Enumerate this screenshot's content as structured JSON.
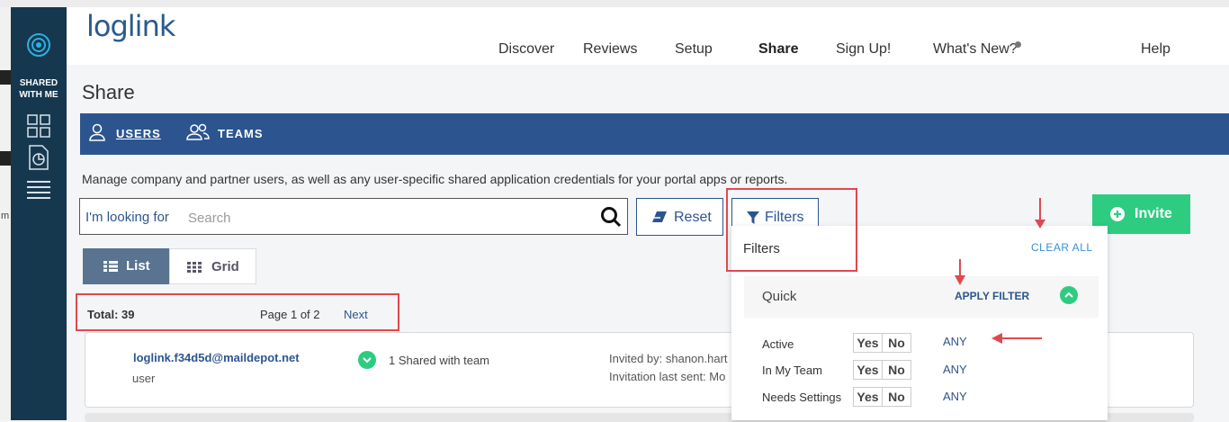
{
  "sidebar": {
    "shared_label_line1": "SHARED",
    "shared_label_line2": "WITH ME"
  },
  "logo": {
    "text": "loglink"
  },
  "nav": [
    {
      "label": "Discover"
    },
    {
      "label": "Reviews"
    },
    {
      "label": "Setup"
    },
    {
      "label": "Share"
    },
    {
      "label": "Sign Up!"
    },
    {
      "label": "What's New?"
    },
    {
      "label": "Help"
    }
  ],
  "page_title": "Share",
  "tabs": [
    {
      "label": "USERS"
    },
    {
      "label": "TEAMS"
    }
  ],
  "description": "Manage company and partner users, as well as any user-specific shared application credentials for your portal apps or reports.",
  "search": {
    "label": "I'm looking for",
    "placeholder": "Search"
  },
  "buttons": {
    "reset": "Reset",
    "filters": "Filters",
    "invite": "Invite"
  },
  "view": {
    "list": "List",
    "grid": "Grid"
  },
  "pagination": {
    "total": "Total: 39",
    "page": "Page 1 of 2",
    "next": "Next"
  },
  "filters_panel": {
    "title": "Filters",
    "clear_all": "CLEAR ALL",
    "section": "Quick",
    "apply": "APPLY FILTER",
    "yes": "Yes",
    "no": "No",
    "rows": [
      {
        "label": "Active",
        "value": "ANY"
      },
      {
        "label": "In My Team",
        "value": "ANY"
      },
      {
        "label": "Needs Settings",
        "value": "ANY"
      }
    ]
  },
  "user_row": {
    "email": "loglink.f34d5d@maildepot.net",
    "role": "user",
    "shared": "1 Shared with team",
    "invited_by": "Invited by: shanon.hart",
    "last_sent": "Invitation last sent: Mo"
  },
  "colors": {
    "sidebar": "#16384f",
    "tabbar": "#2c5590",
    "accent_green": "#2ecc80",
    "annotation_red": "#e04850"
  }
}
